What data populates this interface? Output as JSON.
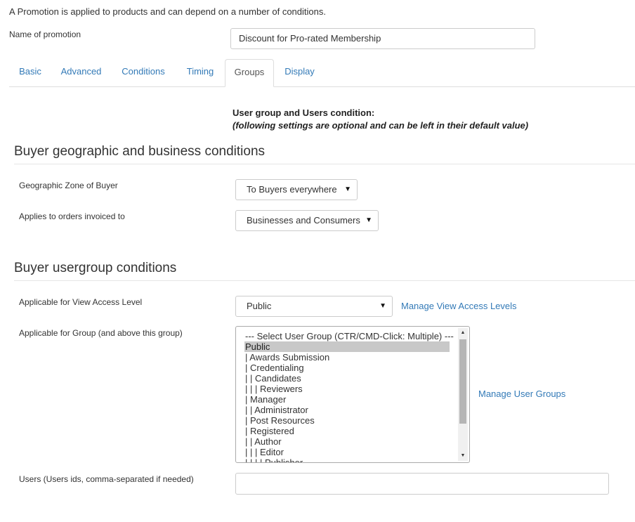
{
  "intro_text": "A Promotion is applied to products and can depend on a number of conditions.",
  "name_field": {
    "label": "Name of promotion",
    "value": "Discount for Pro-rated Membership"
  },
  "tabs": [
    {
      "label": "Basic",
      "active": false
    },
    {
      "label": "Advanced",
      "active": false
    },
    {
      "label": "Conditions",
      "active": false
    },
    {
      "label": "Timing",
      "active": false
    },
    {
      "label": "Groups",
      "active": true
    },
    {
      "label": "Display",
      "active": false
    }
  ],
  "conditions_note": {
    "title": "User group and Users condition:",
    "subtitle": "(following settings are optional and can be left in their default value)"
  },
  "geo_section": {
    "heading": "Buyer geographic and business conditions",
    "zone_label": "Geographic Zone of Buyer",
    "zone_value": "To Buyers everywhere",
    "invoiced_label": "Applies to orders invoiced to",
    "invoiced_value": "Businesses and Consumers"
  },
  "usergroup_section": {
    "heading": "Buyer usergroup conditions",
    "access_label": "Applicable for View Access Level",
    "access_value": "Public",
    "access_link": "Manage View Access Levels",
    "group_label": "Applicable for Group (and above this group)",
    "group_placeholder": "--- Select User Group (CTR/CMD-Click: Multiple) ---",
    "group_options": [
      {
        "label": "Public",
        "selected": true
      },
      {
        "label": "| Awards Submission",
        "selected": false
      },
      {
        "label": "| Credentialing",
        "selected": false
      },
      {
        "label": "| | Candidates",
        "selected": false
      },
      {
        "label": "| | | Reviewers",
        "selected": false
      },
      {
        "label": "| Manager",
        "selected": false
      },
      {
        "label": "| | Administrator",
        "selected": false
      },
      {
        "label": "| Post Resources",
        "selected": false
      },
      {
        "label": "| Registered",
        "selected": false
      },
      {
        "label": "| | Author",
        "selected": false
      },
      {
        "label": "| | | Editor",
        "selected": false
      },
      {
        "label": "| | | | Publisher",
        "selected": false
      }
    ],
    "group_link": "Manage User Groups",
    "users_label": "Users (Users ids, comma-separated if needed)",
    "users_value": ""
  },
  "icons": {
    "dropdown": "caret-down-icon",
    "scroll_up": "scroll-up-arrow-icon",
    "scroll_down": "scroll-down-arrow-icon"
  }
}
